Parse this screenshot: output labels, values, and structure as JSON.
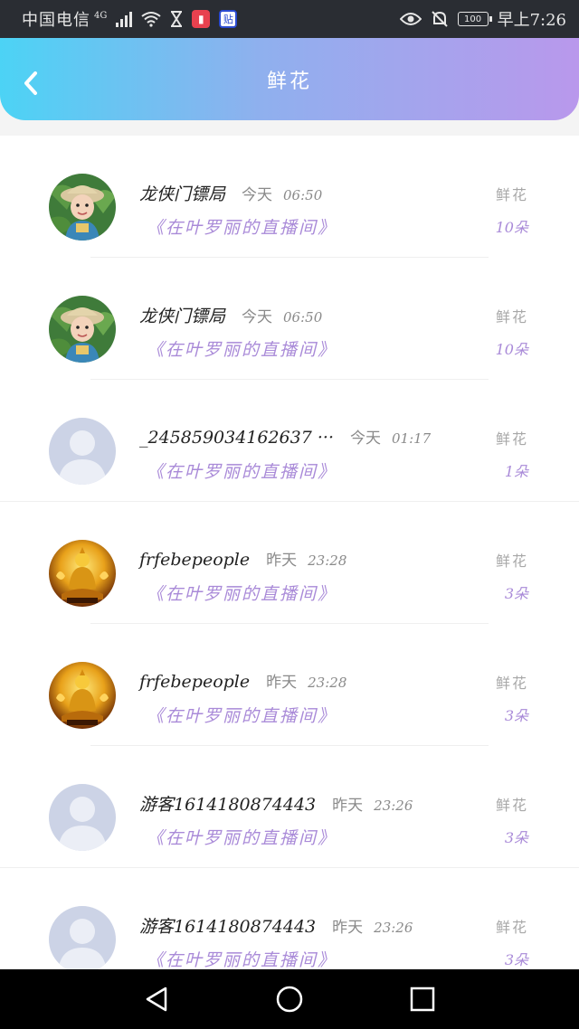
{
  "status_bar": {
    "carrier": "中国电信",
    "network": "4G",
    "battery": "100",
    "time": "早上7:26",
    "app_badge_1": "▮",
    "app_badge_2": "贴"
  },
  "header": {
    "title": "鲜花"
  },
  "records": [
    {
      "name": "龙侠门镖局",
      "day": "今天",
      "time": "06:50",
      "room": "《在叶罗丽的直播间》",
      "gift": "鲜花",
      "count": "10朵",
      "avatar": "child"
    },
    {
      "name": "龙侠门镖局",
      "day": "今天",
      "time": "06:50",
      "room": "《在叶罗丽的直播间》",
      "gift": "鲜花",
      "count": "10朵",
      "avatar": "child"
    },
    {
      "name": "_245859034162637 ···",
      "day": "今天",
      "time": "01:17",
      "room": "《在叶罗丽的直播间》",
      "gift": "鲜花",
      "count": "1朵",
      "avatar": "default"
    },
    {
      "name": "frfebepeople",
      "day": "昨天",
      "time": "23:28",
      "room": "《在叶罗丽的直播间》",
      "gift": "鲜花",
      "count": "3朵",
      "avatar": "buddha"
    },
    {
      "name": "frfebepeople",
      "day": "昨天",
      "time": "23:28",
      "room": "《在叶罗丽的直播间》",
      "gift": "鲜花",
      "count": "3朵",
      "avatar": "buddha"
    },
    {
      "name": "游客1614180874443",
      "day": "昨天",
      "time": "23:26",
      "room": "《在叶罗丽的直播间》",
      "gift": "鲜花",
      "count": "3朵",
      "avatar": "default"
    },
    {
      "name": "游客1614180874443",
      "day": "昨天",
      "time": "23:26",
      "room": "《在叶罗丽的直播间》",
      "gift": "鲜花",
      "count": "3朵",
      "avatar": "default"
    }
  ],
  "colors": {
    "header_gradient_start": "#4cd3f5",
    "header_gradient_end": "#b998ec",
    "accent_purple": "#a98ad8"
  },
  "icons": {
    "back": "chevron-left-icon",
    "nav_back": "triangle-back-icon",
    "nav_home": "circle-home-icon",
    "nav_recent": "square-recent-icon"
  }
}
